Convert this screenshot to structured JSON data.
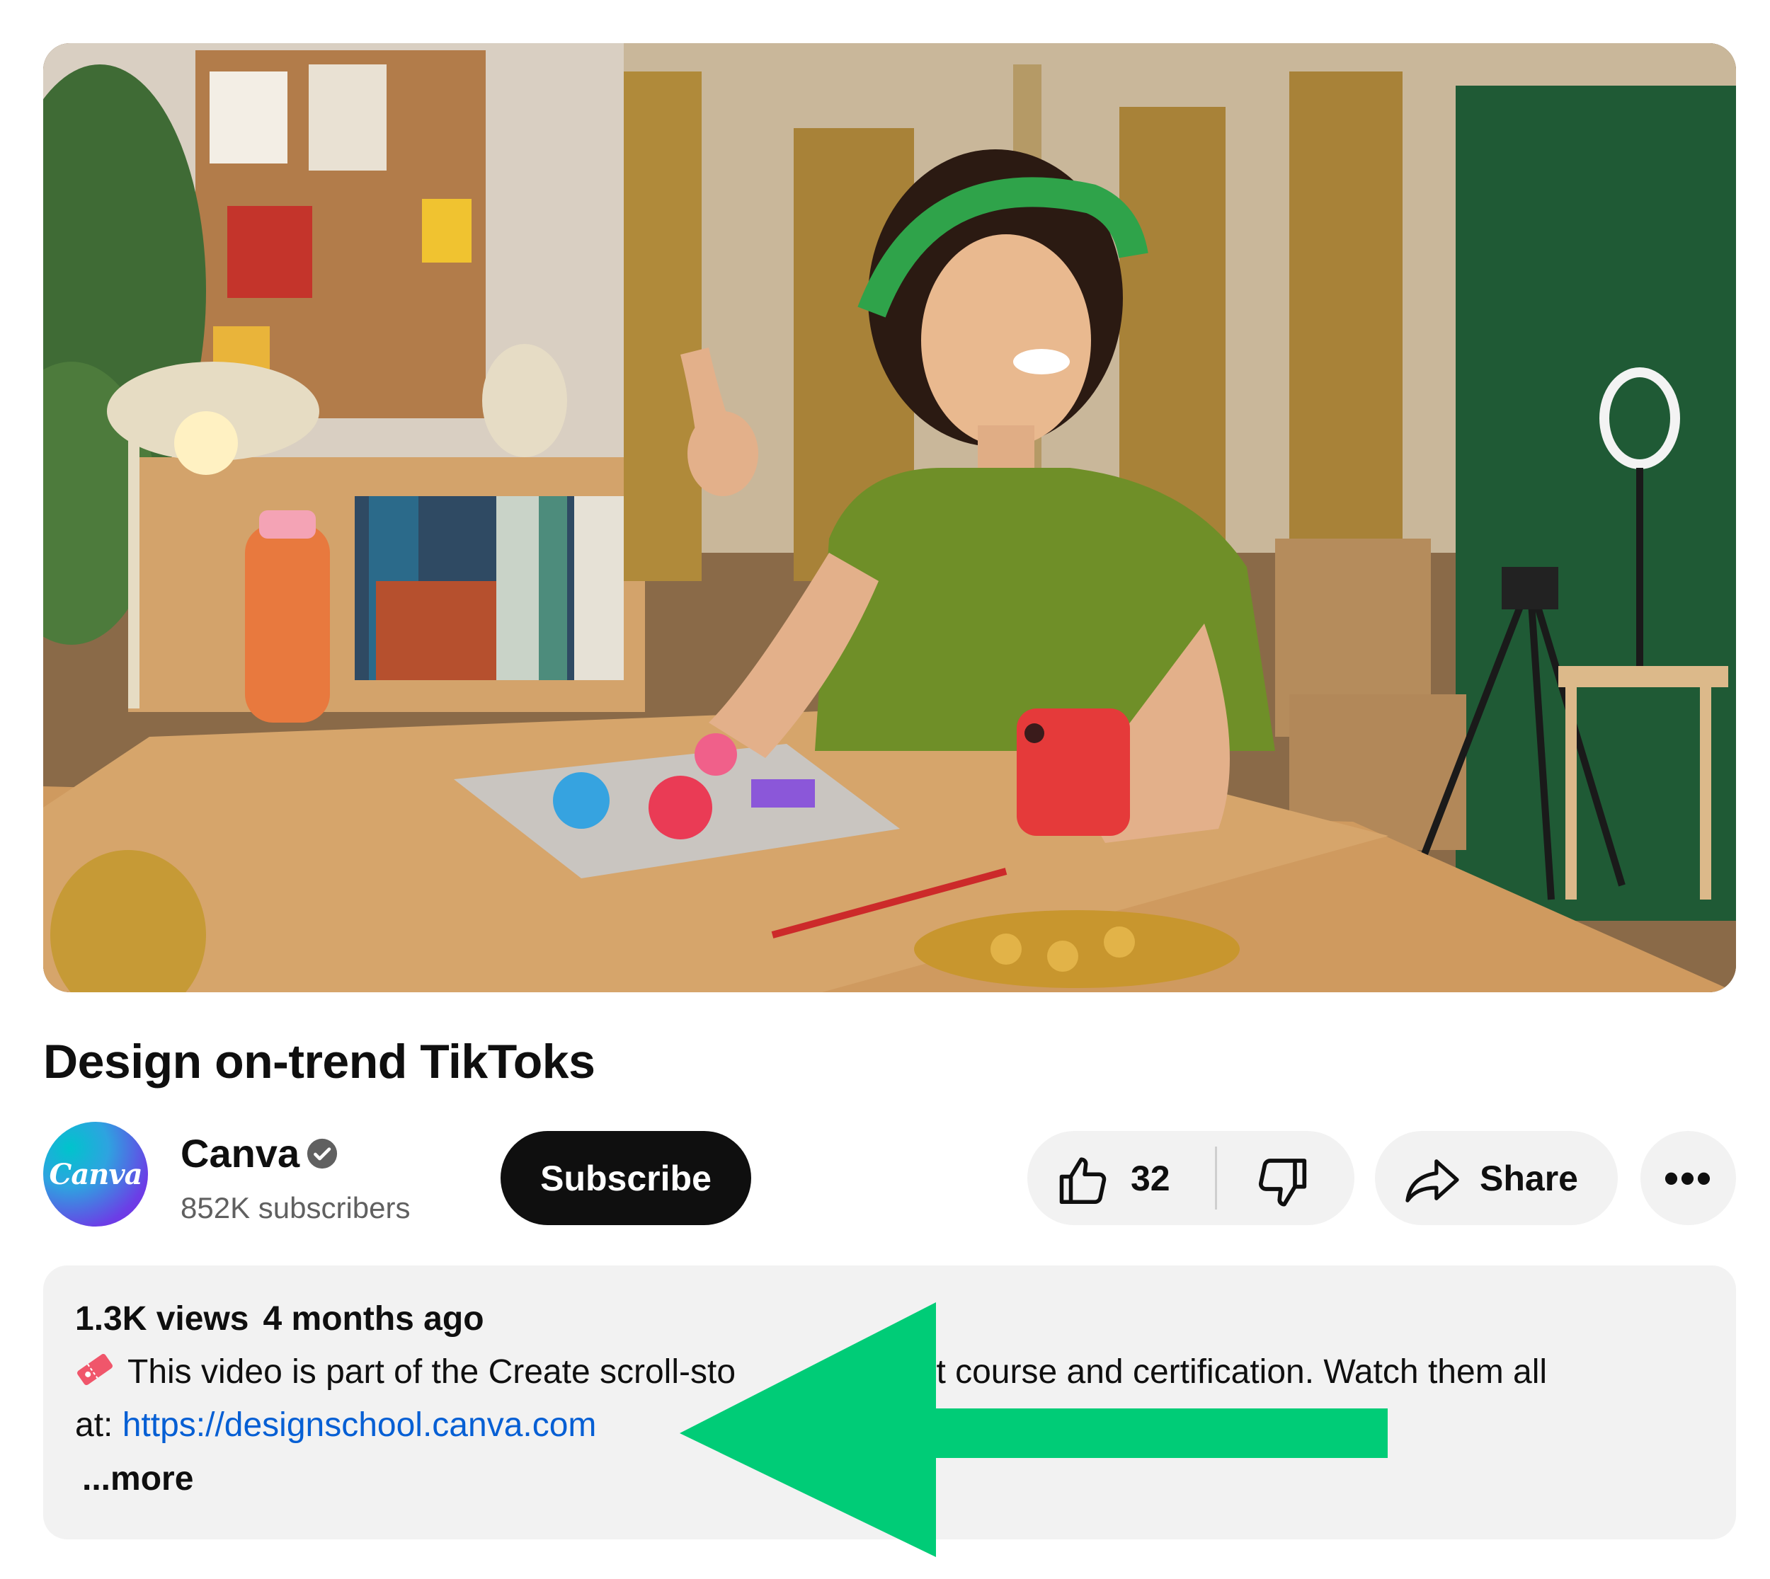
{
  "video": {
    "title": "Design on-trend TikToks"
  },
  "channel": {
    "name": "Canva",
    "logo_text": "Canva",
    "subscribers": "852K subscribers",
    "verified_icon": "verified-check-icon"
  },
  "actions": {
    "subscribe_label": "Subscribe",
    "like_count": "32",
    "share_label": "Share",
    "more_label": "•••",
    "like_icon": "thumbs-up-icon",
    "dislike_icon": "thumbs-down-icon",
    "share_icon": "share-arrow-icon",
    "more_icon": "more-horizontal-icon"
  },
  "description": {
    "views": "1.3K views",
    "age": "4 months ago",
    "line1": "This video is part of the Create scroll-sto",
    "line1_tail": "ntent course and certification. Watch them all",
    "line2_prefix": "at: ",
    "link": "https://designschool.canva.com",
    "more": "...more",
    "ticket_icon": "ticket-emoji-icon"
  },
  "annotation": {
    "arrow_color": "#00cc77"
  },
  "colors": {
    "subscribe_bg": "#0f0f0f",
    "pill_bg": "#f2f2f2",
    "link": "#065fd4",
    "secondary_text": "#606060"
  }
}
